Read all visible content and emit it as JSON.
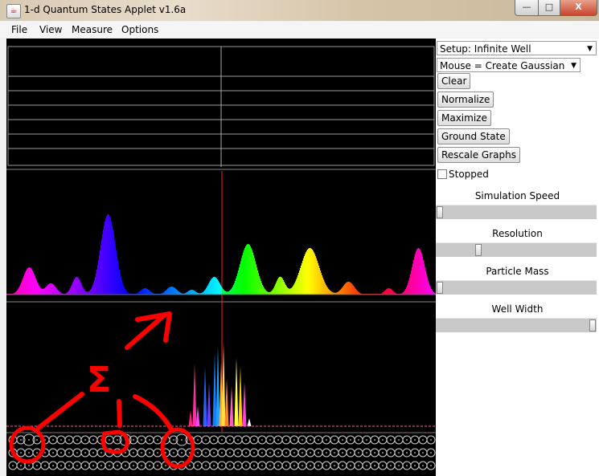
{
  "window": {
    "title": "1-d Quantum States Applet v1.6a",
    "min": "—",
    "max": "□",
    "close": "X"
  },
  "menu": [
    "File",
    "View",
    "Measure",
    "Options"
  ],
  "panel": {
    "setup": "Setup: Infinite Well",
    "mouse_mode": "Mouse = Create Gaussian",
    "buttons": [
      "Clear",
      "Normalize",
      "Maximize",
      "Ground State",
      "Rescale Graphs"
    ],
    "stopped_label": "Stopped",
    "stopped_checked": false,
    "sliders": [
      {
        "label": "Simulation Speed",
        "value": 0.0
      },
      {
        "label": "Resolution",
        "value": 0.25
      },
      {
        "label": "Particle Mass",
        "value": 0.0
      },
      {
        "label": "Well Width",
        "value": 1.0
      }
    ]
  },
  "annotation": {
    "symbol": "Σ",
    "color": "#ff0000"
  }
}
